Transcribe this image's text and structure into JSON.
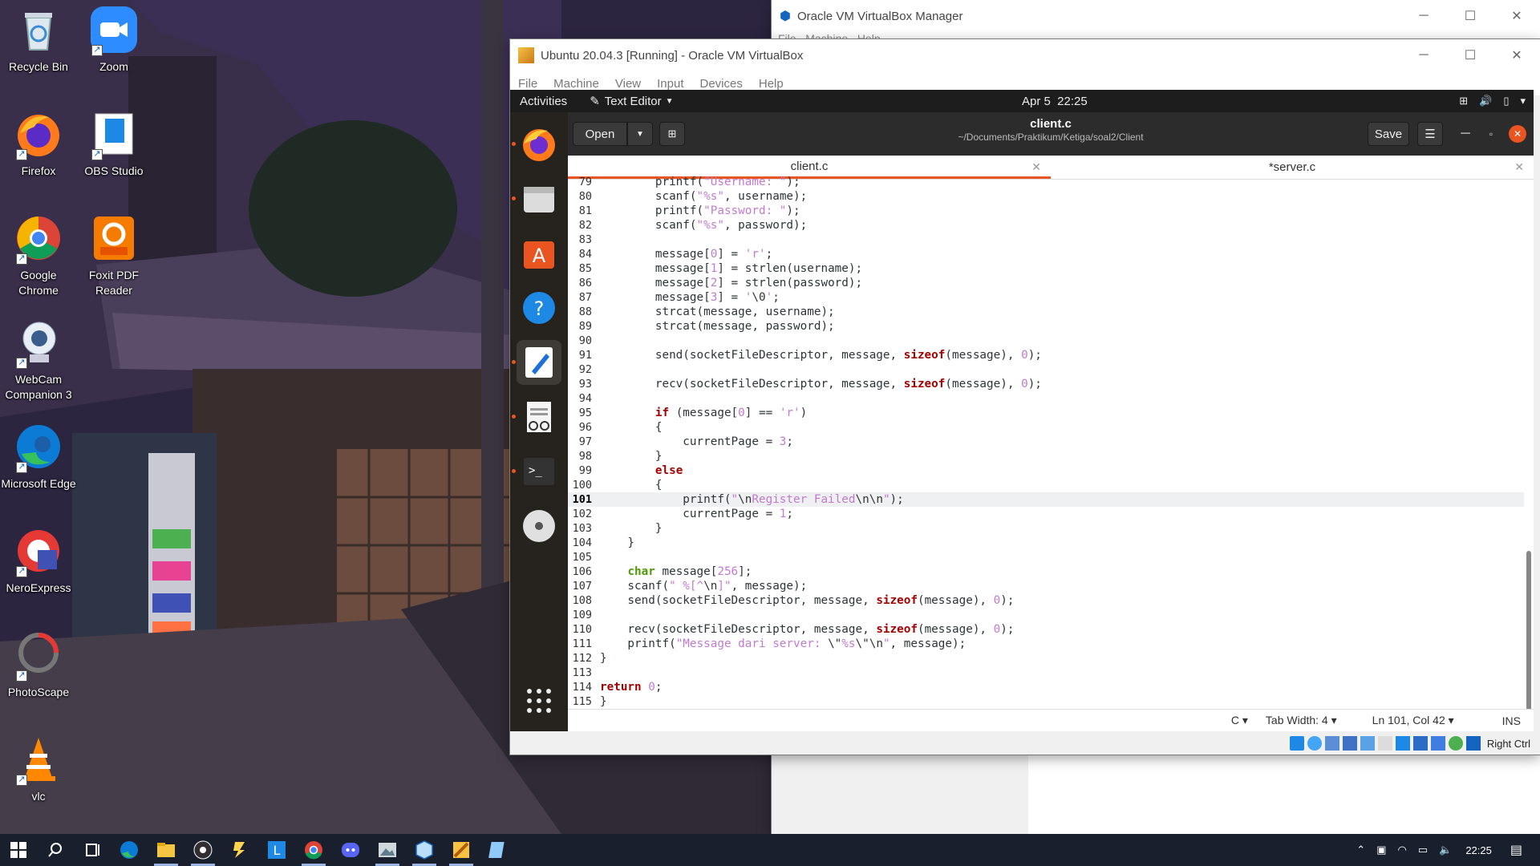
{
  "desktop": {
    "icons": [
      {
        "label": "Recycle Bin",
        "icon": "recycle-bin-icon"
      },
      {
        "label": "Zoom",
        "icon": "zoom-icon"
      },
      {
        "label": "Firefox",
        "icon": "firefox-icon"
      },
      {
        "label": "OBS Studio",
        "icon": "obs-icon"
      },
      {
        "label": "Google Chrome",
        "icon": "chrome-icon"
      },
      {
        "label": "Foxit PDF Reader",
        "icon": "foxit-icon"
      },
      {
        "label": "WebCam Companion 3",
        "icon": "webcam-icon"
      },
      {
        "label": "Microsoft Edge",
        "icon": "edge-icon"
      },
      {
        "label": "NeroExpress",
        "icon": "nero-icon"
      },
      {
        "label": "PhotoScape",
        "icon": "photoscape-icon"
      },
      {
        "label": "vlc",
        "icon": "vlc-icon"
      }
    ]
  },
  "vbox_manager": {
    "title": "Oracle VM VirtualBox Manager",
    "menu": "File   Machine   Help"
  },
  "vm_window": {
    "title": "Ubuntu 20.04.3 [Running] - Oracle VM VirtualBox",
    "menu": [
      "File",
      "Machine",
      "View",
      "Input",
      "Devices",
      "Help"
    ],
    "host_key": "Right Ctrl"
  },
  "gnome": {
    "activities": "Activities",
    "app_menu": "Text Editor",
    "clock": "Apr 5  22:25"
  },
  "gedit": {
    "open_label": "Open",
    "save_label": "Save",
    "filename": "client.c",
    "path": "~/Documents/Praktikum/Ketiga/soal2/Client",
    "tabs": [
      {
        "label": "client.c",
        "active": true
      },
      {
        "label": "*server.c",
        "active": false
      }
    ],
    "status": {
      "language": "C",
      "tab_width": "Tab Width: 4",
      "position": "Ln 101, Col 42",
      "mode": "INS"
    },
    "current_line": 101
  },
  "code_lines": [
    {
      "n": "79",
      "t": "        printf(\"Username: \");"
    },
    {
      "n": "80",
      "t": "        scanf(\"%s\", username);"
    },
    {
      "n": "81",
      "t": "        printf(\"Password: \");"
    },
    {
      "n": "82",
      "t": "        scanf(\"%s\", password);"
    },
    {
      "n": "83",
      "t": ""
    },
    {
      "n": "84",
      "t": "        message[0] = 'r';"
    },
    {
      "n": "85",
      "t": "        message[1] = strlen(username);"
    },
    {
      "n": "86",
      "t": "        message[2] = strlen(password);"
    },
    {
      "n": "87",
      "t": "        message[3] = '\\0';"
    },
    {
      "n": "88",
      "t": "        strcat(message, username);"
    },
    {
      "n": "89",
      "t": "        strcat(message, password);"
    },
    {
      "n": "90",
      "t": ""
    },
    {
      "n": "91",
      "t": "        send(socketFileDescriptor, message, sizeof(message), 0);"
    },
    {
      "n": "92",
      "t": ""
    },
    {
      "n": "93",
      "t": "        recv(socketFileDescriptor, message, sizeof(message), 0);"
    },
    {
      "n": "94",
      "t": ""
    },
    {
      "n": "95",
      "t": "        if (message[0] == 'r')"
    },
    {
      "n": "96",
      "t": "        {"
    },
    {
      "n": "97",
      "t": "            currentPage = 3;"
    },
    {
      "n": "98",
      "t": "        }"
    },
    {
      "n": "99",
      "t": "        else"
    },
    {
      "n": "100",
      "t": "        {"
    },
    {
      "n": "101",
      "t": "            printf(\"\\nRegister Failed\\n\\n\");"
    },
    {
      "n": "102",
      "t": "            currentPage = 1;"
    },
    {
      "n": "103",
      "t": "        }"
    },
    {
      "n": "104",
      "t": "    }"
    },
    {
      "n": "105",
      "t": ""
    },
    {
      "n": "106",
      "t": "    char message[256];"
    },
    {
      "n": "107",
      "t": "    scanf(\" %[^\\n]\", message);"
    },
    {
      "n": "108",
      "t": "    send(socketFileDescriptor, message, sizeof(message), 0);"
    },
    {
      "n": "109",
      "t": ""
    },
    {
      "n": "110",
      "t": "    recv(socketFileDescriptor, message, sizeof(message), 0);"
    },
    {
      "n": "111",
      "t": "    printf(\"Message dari server: \\\"%s\\\"\\n\", message);"
    },
    {
      "n": "112",
      "t": "}"
    },
    {
      "n": "113",
      "t": ""
    },
    {
      "n": "114",
      "t": "return 0;"
    },
    {
      "n": "115",
      "t": "}"
    }
  ],
  "taskbar": {
    "apps": [
      "start-icon",
      "search-icon",
      "task-view-icon",
      "edge-icon",
      "file-explorer-icon",
      "obs-icon",
      "winrar-icon",
      "l-app-icon",
      "chrome-icon",
      "discord-icon",
      "photos-icon",
      "virtualbox-icon",
      "vm-window-icon",
      "notepad-icon"
    ],
    "clock": "22:25"
  },
  "colors": {
    "ubuntu_orange": "#e95420",
    "keyword": "#a40000",
    "type": "#4e9a06",
    "string": "#c17ad0"
  }
}
